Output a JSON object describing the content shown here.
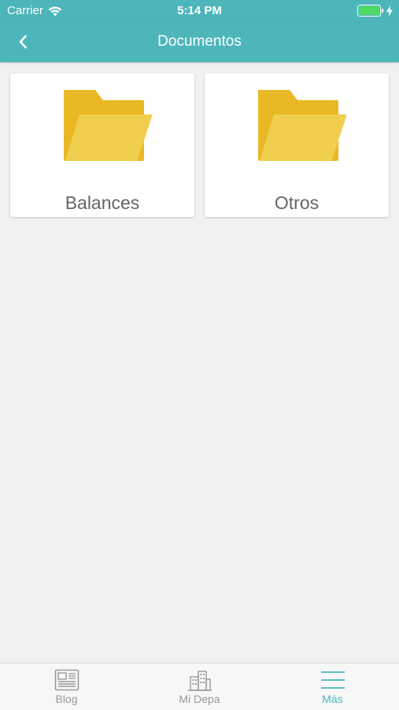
{
  "status_bar": {
    "carrier": "Carrier",
    "time": "5:14 PM",
    "battery_level": 1.0
  },
  "header": {
    "title": "Documentos",
    "back_icon": "chevron-left-icon"
  },
  "folders": [
    {
      "label": "Balances",
      "icon": "folder-icon"
    },
    {
      "label": "Otros",
      "icon": "folder-icon"
    }
  ],
  "tabbar": {
    "tabs": [
      {
        "label": "Blog",
        "icon": "newspaper-icon",
        "active": false
      },
      {
        "label": "Mi Depa",
        "icon": "building-icon",
        "active": false
      },
      {
        "label": "Más",
        "icon": "hamburger-menu-icon",
        "active": true
      }
    ]
  },
  "colors": {
    "accent": "#4db6bb",
    "folder_back": "#e9b824",
    "folder_front": "#f0cf4f",
    "battery": "#4cd964"
  }
}
